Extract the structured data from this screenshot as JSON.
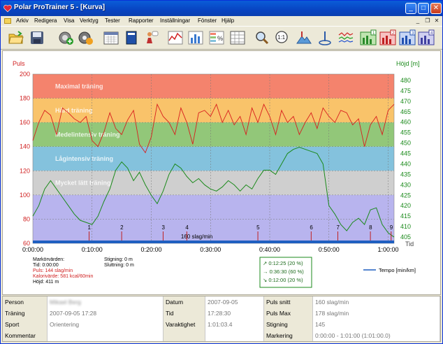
{
  "window": {
    "title": "Polar ProTrainer 5 - [Kurva]"
  },
  "menu": [
    "Arkiv",
    "Redigera",
    "Visa",
    "Verktyg",
    "Tester",
    "Rapporter",
    "Inställningar",
    "Fönster",
    "Hjälp"
  ],
  "toolbar": {
    "icons": [
      "open-folder-icon",
      "save-disk-icon",
      "add-exercise-icon",
      "settings-gear-icon",
      "calendar-icon",
      "diary-book-icon",
      "person-fitness-test-icon",
      "curve-graph-icon",
      "bar-graph-icon",
      "percent-zones-icon",
      "table-grid-icon",
      "magnify-icon",
      "zoom-11-icon",
      "altitude-icon",
      "marker-icon",
      "multi-curve-icon",
      "view-1-icon",
      "view-2-icon",
      "view-3-icon",
      "view-4-icon",
      "view-5-icon"
    ],
    "view_numbers": [
      "1",
      "2",
      "3",
      "4",
      "5"
    ]
  },
  "chart": {
    "left_axis_title": "Puls",
    "right_axis_title": "Höjd [m]",
    "x_axis_title": "Tid",
    "left_ticks": [
      "200",
      "180",
      "160",
      "140",
      "120",
      "100",
      "80",
      "60"
    ],
    "right_ticks": [
      "480",
      "475",
      "470",
      "465",
      "460",
      "455",
      "450",
      "445",
      "440",
      "435",
      "430",
      "425",
      "420",
      "415",
      "410",
      "405"
    ],
    "x_ticks": [
      "0:00:00",
      "0:10:00",
      "0:20:00",
      "0:30:00",
      "0:40:00",
      "0:50:00",
      "1:00:00"
    ],
    "zones": [
      {
        "name": "Maximal träning",
        "color": "#f4836d"
      },
      {
        "name": "Hård träning",
        "color": "#f9c36a"
      },
      {
        "name": "Medelintensiv träning",
        "color": "#92c779"
      },
      {
        "name": "Lågintensiv träning",
        "color": "#84c2dd"
      },
      {
        "name": "Mycket lätt träning",
        "color": "#cfcfcf"
      }
    ],
    "markers": [
      "1",
      "2",
      "3",
      "4",
      "5",
      "6",
      "7",
      "8",
      "9"
    ],
    "pace_label": "160 slag/min",
    "legend": "Tempo [min/km]",
    "colors": {
      "pulse": "#d81e1e",
      "altitude": "#1b8a1b",
      "below": "#b8b4ee",
      "tempo": "#1f5fc0"
    }
  },
  "chart_data": {
    "type": "line",
    "title": "",
    "xlabel": "Tid",
    "ylabel": "Puls",
    "y2label": "Höjd [m]",
    "xlim_min": [
      0,
      61
    ],
    "ylim": [
      60,
      200
    ],
    "y2lim": [
      402,
      483
    ],
    "zones_bpm": [
      [
        180,
        200
      ],
      [
        160,
        180
      ],
      [
        140,
        160
      ],
      [
        120,
        140
      ],
      [
        100,
        120
      ]
    ],
    "series": [
      {
        "name": "Puls",
        "x": [
          0,
          1,
          2,
          3,
          4,
          5,
          6,
          7,
          8,
          9,
          10,
          11,
          12,
          13,
          14,
          15,
          16,
          17,
          18,
          19,
          20,
          21,
          22,
          23,
          24,
          25,
          26,
          27,
          28,
          29,
          30,
          31,
          32,
          33,
          34,
          35,
          36,
          37,
          38,
          39,
          40,
          41,
          42,
          43,
          44,
          45,
          46,
          47,
          48,
          49,
          50,
          51,
          52,
          53,
          54,
          55,
          56,
          57,
          58,
          59,
          60,
          61
        ],
        "values": [
          145,
          160,
          170,
          166,
          150,
          172,
          168,
          163,
          160,
          165,
          145,
          140,
          152,
          168,
          155,
          150,
          162,
          170,
          142,
          135,
          148,
          175,
          165,
          160,
          150,
          172,
          160,
          142,
          168,
          170,
          165,
          175,
          160,
          170,
          158,
          165,
          150,
          172,
          160,
          175,
          165,
          150,
          170,
          160,
          165,
          150,
          160,
          168,
          155,
          172,
          165,
          160,
          170,
          168,
          158,
          163,
          140,
          158,
          165,
          150,
          170,
          175
        ]
      },
      {
        "name": "Höjd",
        "x": [
          0,
          1,
          2,
          3,
          4,
          5,
          6,
          7,
          8,
          9,
          10,
          11,
          12,
          13,
          14,
          15,
          16,
          17,
          18,
          19,
          20,
          21,
          22,
          23,
          24,
          25,
          26,
          27,
          28,
          29,
          30,
          31,
          32,
          33,
          34,
          35,
          36,
          37,
          38,
          39,
          40,
          41,
          42,
          43,
          44,
          45,
          46,
          47,
          48,
          49,
          50,
          51,
          52,
          53,
          54,
          55,
          56,
          57,
          58,
          59,
          60,
          61
        ],
        "values": [
          415,
          420,
          428,
          432,
          428,
          424,
          420,
          416,
          413,
          412,
          411,
          415,
          422,
          428,
          437,
          441,
          438,
          432,
          436,
          430,
          425,
          421,
          427,
          435,
          440,
          438,
          434,
          431,
          433,
          430,
          428,
          427,
          429,
          432,
          430,
          427,
          430,
          428,
          433,
          437,
          437,
          435,
          440,
          445,
          447,
          448,
          447,
          446,
          445,
          440,
          420,
          416,
          411,
          408,
          412,
          414,
          411,
          418,
          419,
          411,
          407,
          405
        ]
      }
    ],
    "marker_times_min": [
      9.5,
      15,
      22,
      26,
      38,
      47,
      51.5,
      57,
      60.5
    ],
    "stats": [
      {
        "label": "Markörvärden:",
        "value": ""
      },
      {
        "label": "Tid:",
        "value": "0:00:00"
      },
      {
        "label": "Puls:",
        "value": "144 slag/min"
      },
      {
        "label": "Kalorivärde:",
        "value": "581 kcal/60min"
      },
      {
        "label": "Höjd:",
        "value": "411 m"
      }
    ],
    "stats2": [
      {
        "label": "Stigning:",
        "value": "0 m"
      },
      {
        "label": "Sluttning:",
        "value": "0 m"
      }
    ],
    "time_split": [
      "0:12:25 (20 %)",
      "0:36:30 (60 %)",
      "0:12:00 (20 %)"
    ]
  },
  "table": {
    "rows": [
      [
        {
          "k": "Person"
        },
        {
          "v": "Mikael Berg",
          "blur": true
        },
        {
          "k": "Datum"
        },
        {
          "v": "2007-09-05"
        },
        {
          "k": "Puls snitt"
        },
        {
          "v": "160 slag/min"
        }
      ],
      [
        {
          "k": "Träning"
        },
        {
          "v": "2007-09-05 17:28"
        },
        {
          "k": "Tid"
        },
        {
          "v": "17:28:30"
        },
        {
          "k": "Puls Max"
        },
        {
          "v": "178 slag/min"
        }
      ],
      [
        {
          "k": "Sport"
        },
        {
          "v": "Orientering"
        },
        {
          "k": "Varaktighet"
        },
        {
          "v": "1:01:03.4"
        },
        {
          "k": "Stigning"
        },
        {
          "v": "145"
        }
      ],
      [
        {
          "k": "Kommentar"
        },
        {
          "v": ""
        },
        {
          "k": ""
        },
        {
          "v": ""
        },
        {
          "k": "Markering"
        },
        {
          "v": "0:00:00 - 1:01:00 (1:01:00.0)"
        }
      ]
    ]
  }
}
